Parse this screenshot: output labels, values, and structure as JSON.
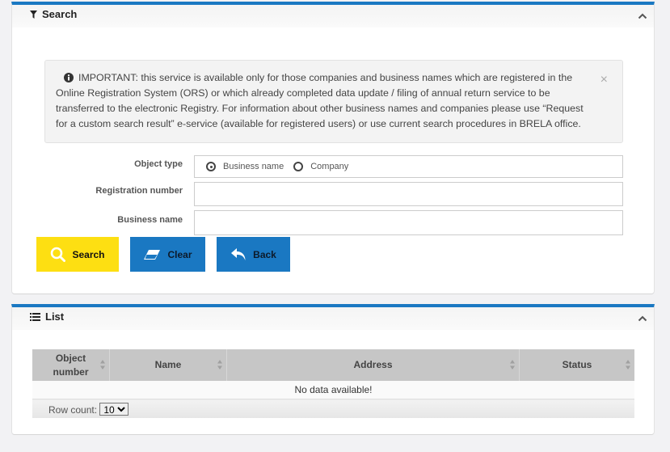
{
  "search_panel": {
    "title": "Search",
    "icon": "filter-icon",
    "alert": {
      "text": "IMPORTANT: this service is available only for those companies and business names which are registered in the Online Registration System (ORS) or which already completed data update / filing of annual return service to be transferred to the electronic Registry. For information about other business names and companies please use “Request for a custom search result” e-service (available for registered users) or use current search procedures in BRELA office.",
      "close": "×"
    },
    "fields": {
      "object_type_label": "Object type",
      "object_type_options": [
        "Business name",
        "Company"
      ],
      "object_type_selected": "Business name",
      "registration_number_label": "Registration number",
      "registration_number_value": "",
      "business_name_label": "Business name",
      "business_name_value": ""
    },
    "buttons": {
      "search": "Search",
      "clear": "Clear",
      "back": "Back"
    }
  },
  "list_panel": {
    "title": "List",
    "icon": "list-icon",
    "columns": [
      "Object number",
      "Name",
      "Address",
      "Status"
    ],
    "empty_message": "No data available!",
    "row_count_label": "Row count:",
    "row_count_value": "10"
  },
  "colors": {
    "accent": "#1a78c2",
    "search_button": "#fddf12",
    "header_bg": "#c6c6c6"
  }
}
